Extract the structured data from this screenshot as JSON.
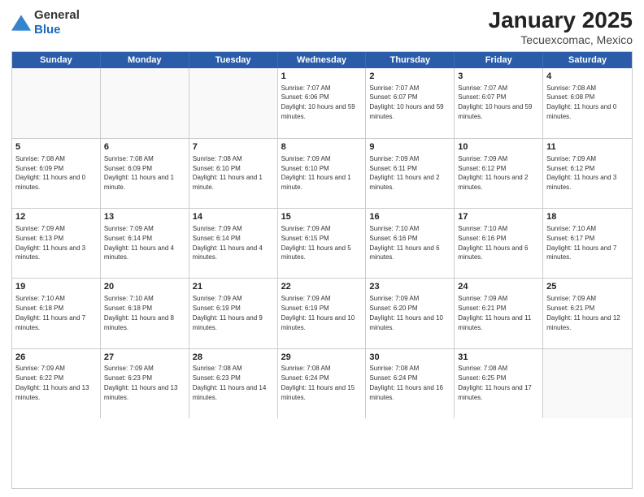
{
  "logo": {
    "general": "General",
    "blue": "Blue"
  },
  "title": "January 2025",
  "subtitle": "Tecuexcomac, Mexico",
  "weekdays": [
    "Sunday",
    "Monday",
    "Tuesday",
    "Wednesday",
    "Thursday",
    "Friday",
    "Saturday"
  ],
  "weeks": [
    [
      {
        "day": "",
        "sunrise": "",
        "sunset": "",
        "daylight": "",
        "empty": true
      },
      {
        "day": "",
        "sunrise": "",
        "sunset": "",
        "daylight": "",
        "empty": true
      },
      {
        "day": "",
        "sunrise": "",
        "sunset": "",
        "daylight": "",
        "empty": true
      },
      {
        "day": "1",
        "sunrise": "Sunrise: 7:07 AM",
        "sunset": "Sunset: 6:06 PM",
        "daylight": "Daylight: 10 hours and 59 minutes."
      },
      {
        "day": "2",
        "sunrise": "Sunrise: 7:07 AM",
        "sunset": "Sunset: 6:07 PM",
        "daylight": "Daylight: 10 hours and 59 minutes."
      },
      {
        "day": "3",
        "sunrise": "Sunrise: 7:07 AM",
        "sunset": "Sunset: 6:07 PM",
        "daylight": "Daylight: 10 hours and 59 minutes."
      },
      {
        "day": "4",
        "sunrise": "Sunrise: 7:08 AM",
        "sunset": "Sunset: 6:08 PM",
        "daylight": "Daylight: 11 hours and 0 minutes."
      }
    ],
    [
      {
        "day": "5",
        "sunrise": "Sunrise: 7:08 AM",
        "sunset": "Sunset: 6:09 PM",
        "daylight": "Daylight: 11 hours and 0 minutes."
      },
      {
        "day": "6",
        "sunrise": "Sunrise: 7:08 AM",
        "sunset": "Sunset: 6:09 PM",
        "daylight": "Daylight: 11 hours and 1 minute."
      },
      {
        "day": "7",
        "sunrise": "Sunrise: 7:08 AM",
        "sunset": "Sunset: 6:10 PM",
        "daylight": "Daylight: 11 hours and 1 minute."
      },
      {
        "day": "8",
        "sunrise": "Sunrise: 7:09 AM",
        "sunset": "Sunset: 6:10 PM",
        "daylight": "Daylight: 11 hours and 1 minute."
      },
      {
        "day": "9",
        "sunrise": "Sunrise: 7:09 AM",
        "sunset": "Sunset: 6:11 PM",
        "daylight": "Daylight: 11 hours and 2 minutes."
      },
      {
        "day": "10",
        "sunrise": "Sunrise: 7:09 AM",
        "sunset": "Sunset: 6:12 PM",
        "daylight": "Daylight: 11 hours and 2 minutes."
      },
      {
        "day": "11",
        "sunrise": "Sunrise: 7:09 AM",
        "sunset": "Sunset: 6:12 PM",
        "daylight": "Daylight: 11 hours and 3 minutes."
      }
    ],
    [
      {
        "day": "12",
        "sunrise": "Sunrise: 7:09 AM",
        "sunset": "Sunset: 6:13 PM",
        "daylight": "Daylight: 11 hours and 3 minutes."
      },
      {
        "day": "13",
        "sunrise": "Sunrise: 7:09 AM",
        "sunset": "Sunset: 6:14 PM",
        "daylight": "Daylight: 11 hours and 4 minutes."
      },
      {
        "day": "14",
        "sunrise": "Sunrise: 7:09 AM",
        "sunset": "Sunset: 6:14 PM",
        "daylight": "Daylight: 11 hours and 4 minutes."
      },
      {
        "day": "15",
        "sunrise": "Sunrise: 7:09 AM",
        "sunset": "Sunset: 6:15 PM",
        "daylight": "Daylight: 11 hours and 5 minutes."
      },
      {
        "day": "16",
        "sunrise": "Sunrise: 7:10 AM",
        "sunset": "Sunset: 6:16 PM",
        "daylight": "Daylight: 11 hours and 6 minutes."
      },
      {
        "day": "17",
        "sunrise": "Sunrise: 7:10 AM",
        "sunset": "Sunset: 6:16 PM",
        "daylight": "Daylight: 11 hours and 6 minutes."
      },
      {
        "day": "18",
        "sunrise": "Sunrise: 7:10 AM",
        "sunset": "Sunset: 6:17 PM",
        "daylight": "Daylight: 11 hours and 7 minutes."
      }
    ],
    [
      {
        "day": "19",
        "sunrise": "Sunrise: 7:10 AM",
        "sunset": "Sunset: 6:18 PM",
        "daylight": "Daylight: 11 hours and 7 minutes."
      },
      {
        "day": "20",
        "sunrise": "Sunrise: 7:10 AM",
        "sunset": "Sunset: 6:18 PM",
        "daylight": "Daylight: 11 hours and 8 minutes."
      },
      {
        "day": "21",
        "sunrise": "Sunrise: 7:09 AM",
        "sunset": "Sunset: 6:19 PM",
        "daylight": "Daylight: 11 hours and 9 minutes."
      },
      {
        "day": "22",
        "sunrise": "Sunrise: 7:09 AM",
        "sunset": "Sunset: 6:19 PM",
        "daylight": "Daylight: 11 hours and 10 minutes."
      },
      {
        "day": "23",
        "sunrise": "Sunrise: 7:09 AM",
        "sunset": "Sunset: 6:20 PM",
        "daylight": "Daylight: 11 hours and 10 minutes."
      },
      {
        "day": "24",
        "sunrise": "Sunrise: 7:09 AM",
        "sunset": "Sunset: 6:21 PM",
        "daylight": "Daylight: 11 hours and 11 minutes."
      },
      {
        "day": "25",
        "sunrise": "Sunrise: 7:09 AM",
        "sunset": "Sunset: 6:21 PM",
        "daylight": "Daylight: 11 hours and 12 minutes."
      }
    ],
    [
      {
        "day": "26",
        "sunrise": "Sunrise: 7:09 AM",
        "sunset": "Sunset: 6:22 PM",
        "daylight": "Daylight: 11 hours and 13 minutes."
      },
      {
        "day": "27",
        "sunrise": "Sunrise: 7:09 AM",
        "sunset": "Sunset: 6:23 PM",
        "daylight": "Daylight: 11 hours and 13 minutes."
      },
      {
        "day": "28",
        "sunrise": "Sunrise: 7:08 AM",
        "sunset": "Sunset: 6:23 PM",
        "daylight": "Daylight: 11 hours and 14 minutes."
      },
      {
        "day": "29",
        "sunrise": "Sunrise: 7:08 AM",
        "sunset": "Sunset: 6:24 PM",
        "daylight": "Daylight: 11 hours and 15 minutes."
      },
      {
        "day": "30",
        "sunrise": "Sunrise: 7:08 AM",
        "sunset": "Sunset: 6:24 PM",
        "daylight": "Daylight: 11 hours and 16 minutes."
      },
      {
        "day": "31",
        "sunrise": "Sunrise: 7:08 AM",
        "sunset": "Sunset: 6:25 PM",
        "daylight": "Daylight: 11 hours and 17 minutes."
      },
      {
        "day": "",
        "sunrise": "",
        "sunset": "",
        "daylight": "",
        "empty": true
      }
    ]
  ]
}
